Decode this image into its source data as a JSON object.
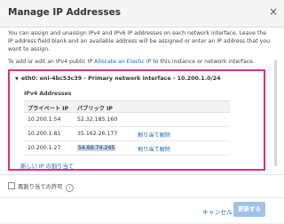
{
  "dialog": {
    "title": "Manage IP Addresses",
    "close_glyph": "×",
    "intro": "You can assign and unassign IPv4 and IPv6 IP addresses on each network interface. Leave the IP address field blank and an available address will be assigned or enter an IP address that you want to assign.",
    "public_ip_prefix": "To add or edit an IPv4 public IP ",
    "public_ip_link": "Allocate an Elastic IP",
    "public_ip_suffix": " to this instance or network interface."
  },
  "interface": {
    "toggle_glyph": "▼",
    "title": "eth0: eni-4bc53c39 - Primary network interface - 10.200.1.0/24",
    "subheading": "IPv4 Addresses",
    "columns": [
      "プライベート IP",
      "パブリック IP"
    ],
    "rows": [
      {
        "private": "10.200.1.54",
        "public": "52.32.185.160",
        "action": ""
      },
      {
        "private": "10.200.1.81",
        "public": "35.162.26.177",
        "action": "割り当て解除"
      },
      {
        "private": "10.200.1.27",
        "public": "54.69.74.245",
        "action": "割り当て解除"
      }
    ],
    "new_ip_label": "新しい IP の割り当て"
  },
  "options": {
    "reassign_label": "再割り当ての許可",
    "info_glyph": "i"
  },
  "footer": {
    "cancel_label": "キャンセル",
    "update_label": "更新する"
  },
  "colors": {
    "highlight_border": "#e22e79",
    "link": "#1a6bb8",
    "primary_button_disabled": "#9fc3e6"
  }
}
